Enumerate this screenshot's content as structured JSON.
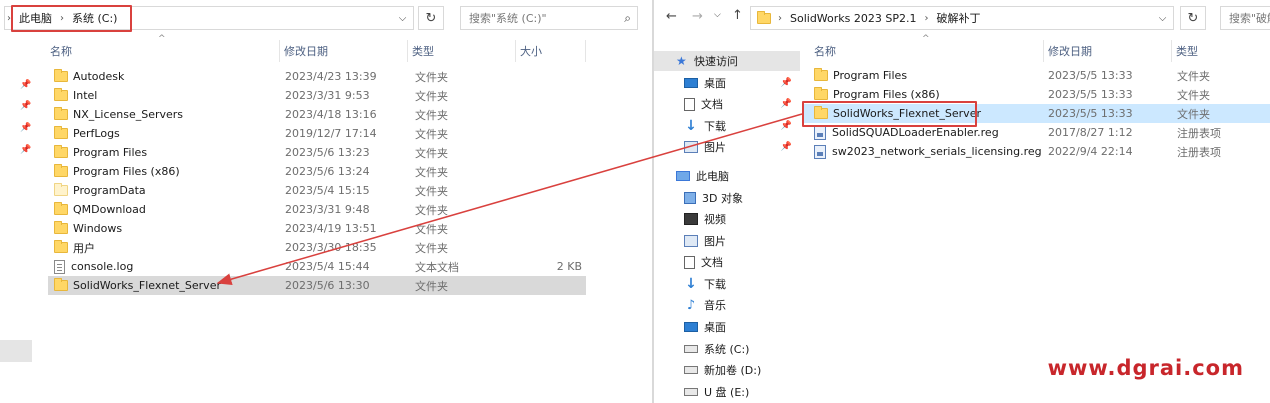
{
  "left": {
    "breadcrumb": [
      "此电脑",
      "系统 (C:)"
    ],
    "search_placeholder": "搜索\"系统 (C:)\"",
    "columns": {
      "name": "名称",
      "date": "修改日期",
      "type": "类型",
      "size": "大小"
    },
    "rows": [
      {
        "name": "Autodesk",
        "date": "2023/4/23 13:39",
        "type": "文件夹",
        "size": "",
        "icon": "folder"
      },
      {
        "name": "Intel",
        "date": "2023/3/31 9:53",
        "type": "文件夹",
        "size": "",
        "icon": "folder"
      },
      {
        "name": "NX_License_Servers",
        "date": "2023/4/18 13:16",
        "type": "文件夹",
        "size": "",
        "icon": "folder"
      },
      {
        "name": "PerfLogs",
        "date": "2019/12/7 17:14",
        "type": "文件夹",
        "size": "",
        "icon": "folder"
      },
      {
        "name": "Program Files",
        "date": "2023/5/6 13:23",
        "type": "文件夹",
        "size": "",
        "icon": "folder"
      },
      {
        "name": "Program Files (x86)",
        "date": "2023/5/6 13:24",
        "type": "文件夹",
        "size": "",
        "icon": "folder"
      },
      {
        "name": "ProgramData",
        "date": "2023/5/4 15:15",
        "type": "文件夹",
        "size": "",
        "icon": "folder-hidden"
      },
      {
        "name": "QMDownload",
        "date": "2023/3/31 9:48",
        "type": "文件夹",
        "size": "",
        "icon": "folder"
      },
      {
        "name": "Windows",
        "date": "2023/4/19 13:51",
        "type": "文件夹",
        "size": "",
        "icon": "folder"
      },
      {
        "name": "用户",
        "date": "2023/3/30 18:35",
        "type": "文件夹",
        "size": "",
        "icon": "folder"
      },
      {
        "name": "console.log",
        "date": "2023/5/4 15:44",
        "type": "文本文档",
        "size": "2 KB",
        "icon": "file"
      },
      {
        "name": "SolidWorks_Flexnet_Server",
        "date": "2023/5/6 13:30",
        "type": "文件夹",
        "size": "",
        "icon": "folder"
      }
    ]
  },
  "right": {
    "breadcrumb": [
      "SolidWorks 2023 SP2.1",
      "破解补丁"
    ],
    "search_placeholder": "搜索\"破解",
    "columns": {
      "name": "名称",
      "date": "修改日期",
      "type": "类型"
    },
    "rows": [
      {
        "name": "Program Files",
        "date": "2023/5/5 13:33",
        "type": "文件夹",
        "icon": "folder"
      },
      {
        "name": "Program Files (x86)",
        "date": "2023/5/5 13:33",
        "type": "文件夹",
        "icon": "folder"
      },
      {
        "name": "SolidWorks_Flexnet_Server",
        "date": "2023/5/5 13:33",
        "type": "文件夹",
        "icon": "folder"
      },
      {
        "name": "SolidSQUADLoaderEnabler.reg",
        "date": "2017/8/27 1:12",
        "type": "注册表项",
        "icon": "reg"
      },
      {
        "name": "sw2023_network_serials_licensing.reg",
        "date": "2022/9/4 22:14",
        "type": "注册表项",
        "icon": "reg"
      }
    ],
    "nav": [
      {
        "label": "快速访问",
        "icon": "star"
      },
      {
        "label": "桌面",
        "icon": "desktop"
      },
      {
        "label": "文档",
        "icon": "doc"
      },
      {
        "label": "下载",
        "icon": "download"
      },
      {
        "label": "图片",
        "icon": "pictures"
      },
      {
        "label": "此电脑",
        "icon": "pc"
      },
      {
        "label": "3D 对象",
        "icon": "3d"
      },
      {
        "label": "视频",
        "icon": "video"
      },
      {
        "label": "图片",
        "icon": "pictures"
      },
      {
        "label": "文档",
        "icon": "doc"
      },
      {
        "label": "下载",
        "icon": "download"
      },
      {
        "label": "音乐",
        "icon": "music"
      },
      {
        "label": "桌面",
        "icon": "desktop"
      },
      {
        "label": "系统 (C:)",
        "icon": "drive"
      },
      {
        "label": "新加卷 (D:)",
        "icon": "drive"
      },
      {
        "label": "U 盘 (E:)",
        "icon": "drive"
      }
    ]
  },
  "watermark": "www.dgrai.com",
  "colors": {
    "highlight_box": "#d9413e",
    "selected_row": "#cce8ff",
    "watermark": "#c8262b"
  }
}
